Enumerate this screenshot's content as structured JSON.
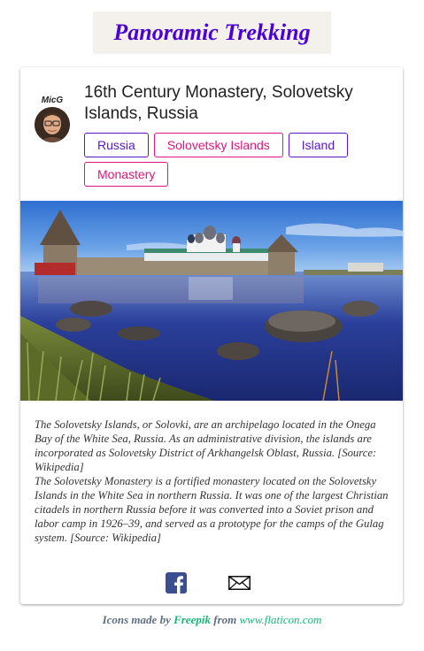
{
  "site": {
    "title": "Panoramic Trekking"
  },
  "post": {
    "author": "MicG",
    "title": "16th Century Monastery, Solovetsky Islands, Russia",
    "tags": [
      {
        "label": "Russia",
        "color": "#5a17c8"
      },
      {
        "label": "Solovetsky Islands",
        "color": "#e0157f"
      },
      {
        "label": "Island",
        "color": "#5a17c8"
      },
      {
        "label": "Monastery",
        "color": "#e0157f"
      }
    ],
    "description": [
      "The Solovetsky Islands, or Solovki, are an archipelago located in the Onega Bay of the White Sea, Russia. As an administrative division, the islands are incorporated as Solovetsky District of Arkhangelsk Oblast, Russia. [Source: Wikipedia]",
      "The Solovetsky Monastery is a fortified monastery located on the Solovetsky Islands in the White Sea in northern Russia. It was one of the largest Christian citadels in northern Russia before it was converted into a Soviet prison and labor camp in 1926–39, and served as a prototype for the camps of the Gulag system. [Source: Wikipedia]"
    ],
    "share": {
      "facebook_icon": "facebook-icon",
      "email_icon": "email-icon"
    }
  },
  "credits": {
    "prefix": "Icons made by",
    "author": "Freepik",
    "middle": "from",
    "site": "www.flaticon.com"
  },
  "colors": {
    "title": "#4b00d6",
    "title_bg": "#f4f1ec",
    "tag_purple": "#5a17c8",
    "tag_pink": "#e0157f",
    "credit_link": "#1bb57c"
  }
}
